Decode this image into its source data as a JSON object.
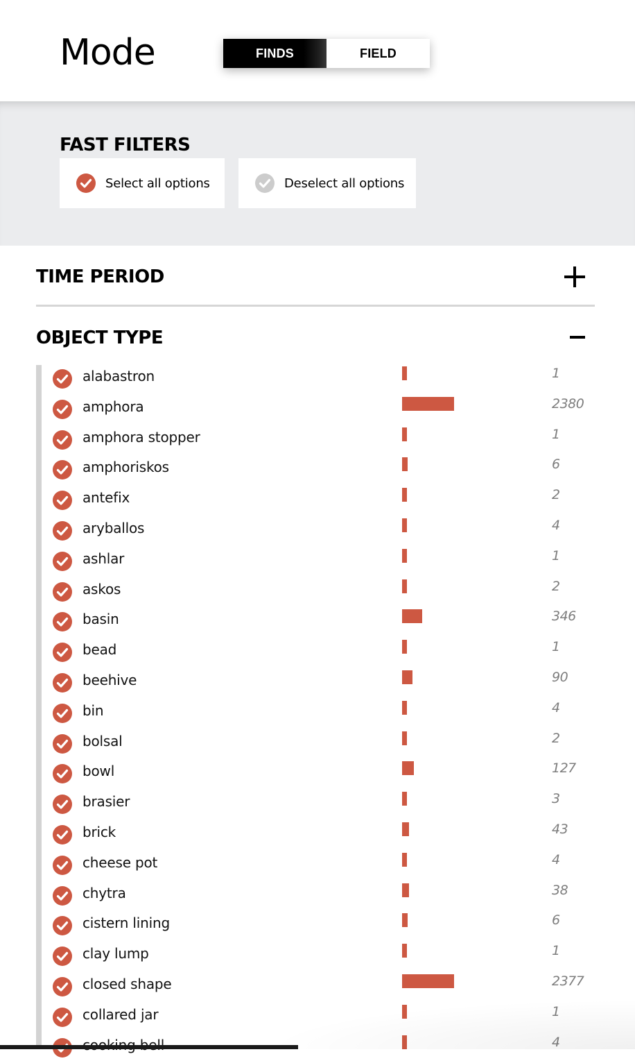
{
  "header": {
    "title": "Mode",
    "toggle": {
      "finds_label": "FINDS",
      "field_label": "FIELD",
      "active": "FINDS"
    }
  },
  "fast_filters": {
    "title": "FAST FILTERS",
    "select_all_label": "Select all options",
    "deselect_all_label": "Deselect all options"
  },
  "sections": {
    "time_period": {
      "label": "TIME PERIOD",
      "expanded": false
    },
    "object_type": {
      "label": "OBJECT TYPE",
      "expanded": true
    }
  },
  "colors": {
    "accent": "#cd5842",
    "check_inactive": "#cccccc",
    "panel_bg": "#ebecee"
  },
  "max_count": 2380,
  "object_types": [
    {
      "name": "alabastron",
      "count": 1
    },
    {
      "name": "amphora",
      "count": 2380
    },
    {
      "name": "amphora stopper",
      "count": 1
    },
    {
      "name": "amphoriskos",
      "count": 6
    },
    {
      "name": "antefix",
      "count": 2
    },
    {
      "name": "aryballos",
      "count": 4
    },
    {
      "name": "ashlar",
      "count": 1
    },
    {
      "name": "askos",
      "count": 2
    },
    {
      "name": "basin",
      "count": 346
    },
    {
      "name": "bead",
      "count": 1
    },
    {
      "name": "beehive",
      "count": 90
    },
    {
      "name": "bin",
      "count": 4
    },
    {
      "name": "bolsal",
      "count": 2
    },
    {
      "name": "bowl",
      "count": 127
    },
    {
      "name": "brasier",
      "count": 3
    },
    {
      "name": "brick",
      "count": 43
    },
    {
      "name": "cheese pot",
      "count": 4
    },
    {
      "name": "chytra",
      "count": 38
    },
    {
      "name": "cistern lining",
      "count": 6
    },
    {
      "name": "clay lump",
      "count": 1
    },
    {
      "name": "closed shape",
      "count": 2377
    },
    {
      "name": "collared jar",
      "count": 1
    },
    {
      "name": "cooking bell",
      "count": 4
    }
  ]
}
